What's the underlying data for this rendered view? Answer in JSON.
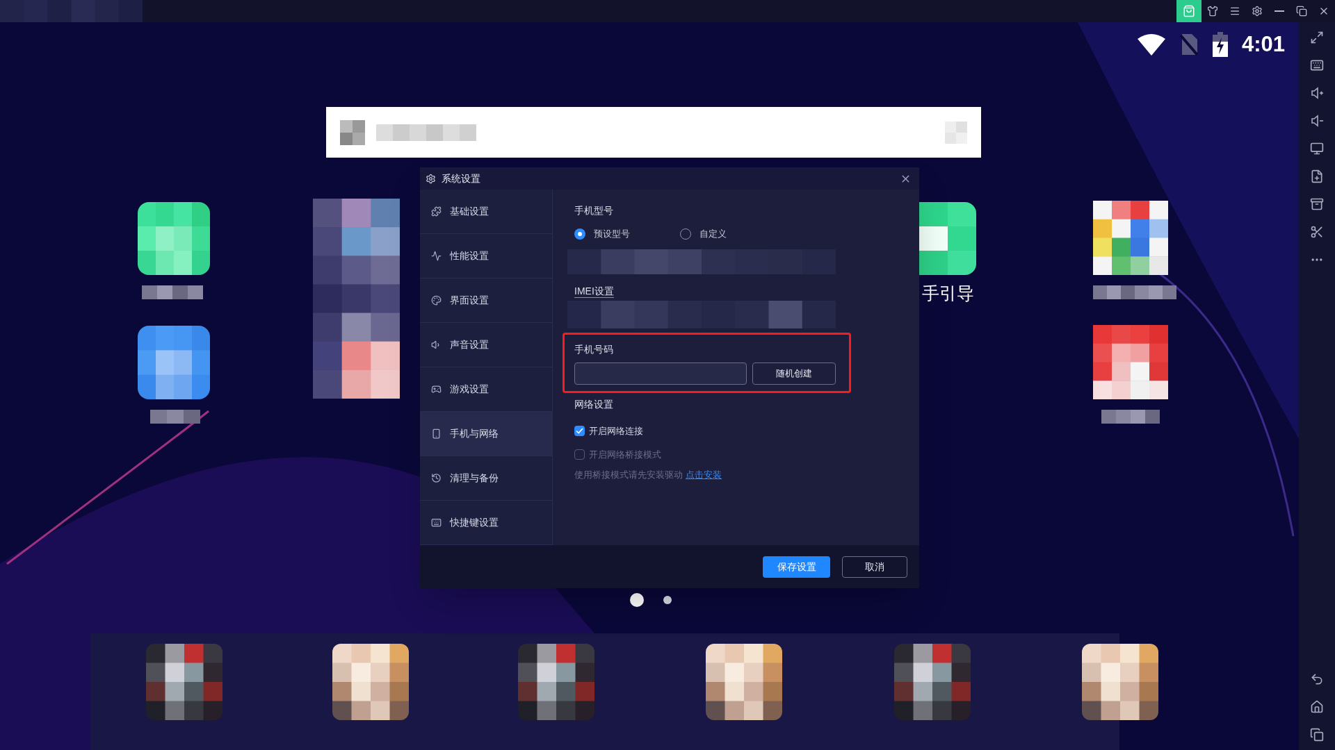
{
  "status_bar": {
    "time": "4:01"
  },
  "desktop": {
    "shortcut_label": "手引导"
  },
  "page_dots": [
    {
      "selected": true
    },
    {
      "selected": false
    }
  ],
  "dialog": {
    "title": "系统设置",
    "sidebar": [
      {
        "label": "基础设置",
        "selected": false
      },
      {
        "label": "性能设置",
        "selected": false
      },
      {
        "label": "界面设置",
        "selected": false
      },
      {
        "label": "声音设置",
        "selected": false
      },
      {
        "label": "游戏设置",
        "selected": false
      },
      {
        "label": "手机与网络",
        "selected": true
      },
      {
        "label": "清理与备份",
        "selected": false
      },
      {
        "label": "快捷键设置",
        "selected": false
      }
    ],
    "phone_model": {
      "heading": "手机型号",
      "options": [
        {
          "label": "预设型号",
          "selected": true
        },
        {
          "label": "自定义",
          "selected": false
        }
      ]
    },
    "imei": {
      "heading": "IMEI设置"
    },
    "phone_number": {
      "heading": "手机号码",
      "button": "随机创建"
    },
    "network": {
      "heading": "网络设置",
      "options": [
        {
          "label": "开启网络连接",
          "checked": true,
          "disabled": false
        },
        {
          "label": "开启网络桥接模式",
          "checked": false,
          "disabled": true
        }
      ],
      "hint": "使用桥接模式请先安装驱动",
      "link": "点击安装"
    },
    "buttons": {
      "save": "保存设置",
      "cancel": "取消"
    }
  }
}
